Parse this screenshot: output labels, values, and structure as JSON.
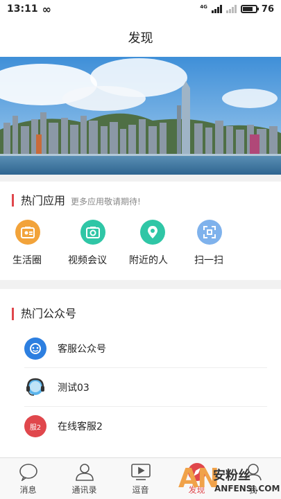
{
  "status": {
    "time": "13:11",
    "network": "4G",
    "battery": "76",
    "battery_level": 0.76
  },
  "header": {
    "title": "发现"
  },
  "hot_apps": {
    "title": "热门应用",
    "subtitle": "更多应用敬请期待!",
    "items": [
      {
        "label": "生活圈",
        "icon": "life-circle-icon",
        "color": "#f2a33a"
      },
      {
        "label": "视频会议",
        "icon": "video-meeting-icon",
        "color": "#2fc6a6"
      },
      {
        "label": "附近的人",
        "icon": "nearby-people-icon",
        "color": "#2fc6a6"
      },
      {
        "label": "扫一扫",
        "icon": "scan-icon",
        "color": "#7fb2ec"
      }
    ]
  },
  "hot_accounts": {
    "title": "热门公众号",
    "items": [
      {
        "name": "客服公众号",
        "avatar": "customer-service-avatar",
        "color": "#2d7fe0"
      },
      {
        "name": "测试03",
        "avatar": "headset-avatar",
        "color": "#5ab4ec"
      },
      {
        "name": "在线客服2",
        "avatar_text": "服2",
        "color": "#e0474c"
      }
    ]
  },
  "tabbar": {
    "items": [
      {
        "label": "消息",
        "icon": "message-icon"
      },
      {
        "label": "通讯录",
        "icon": "contacts-icon"
      },
      {
        "label": "逗音",
        "icon": "video-icon"
      },
      {
        "label": "发现",
        "icon": "discover-icon"
      },
      {
        "label": "我",
        "icon": "profile-icon"
      }
    ],
    "active": "发现",
    "active_color": "#e0474c"
  },
  "watermark": {
    "mark": "AN",
    "cn": "安粉丝",
    "en": "ANFENSI.COM"
  }
}
